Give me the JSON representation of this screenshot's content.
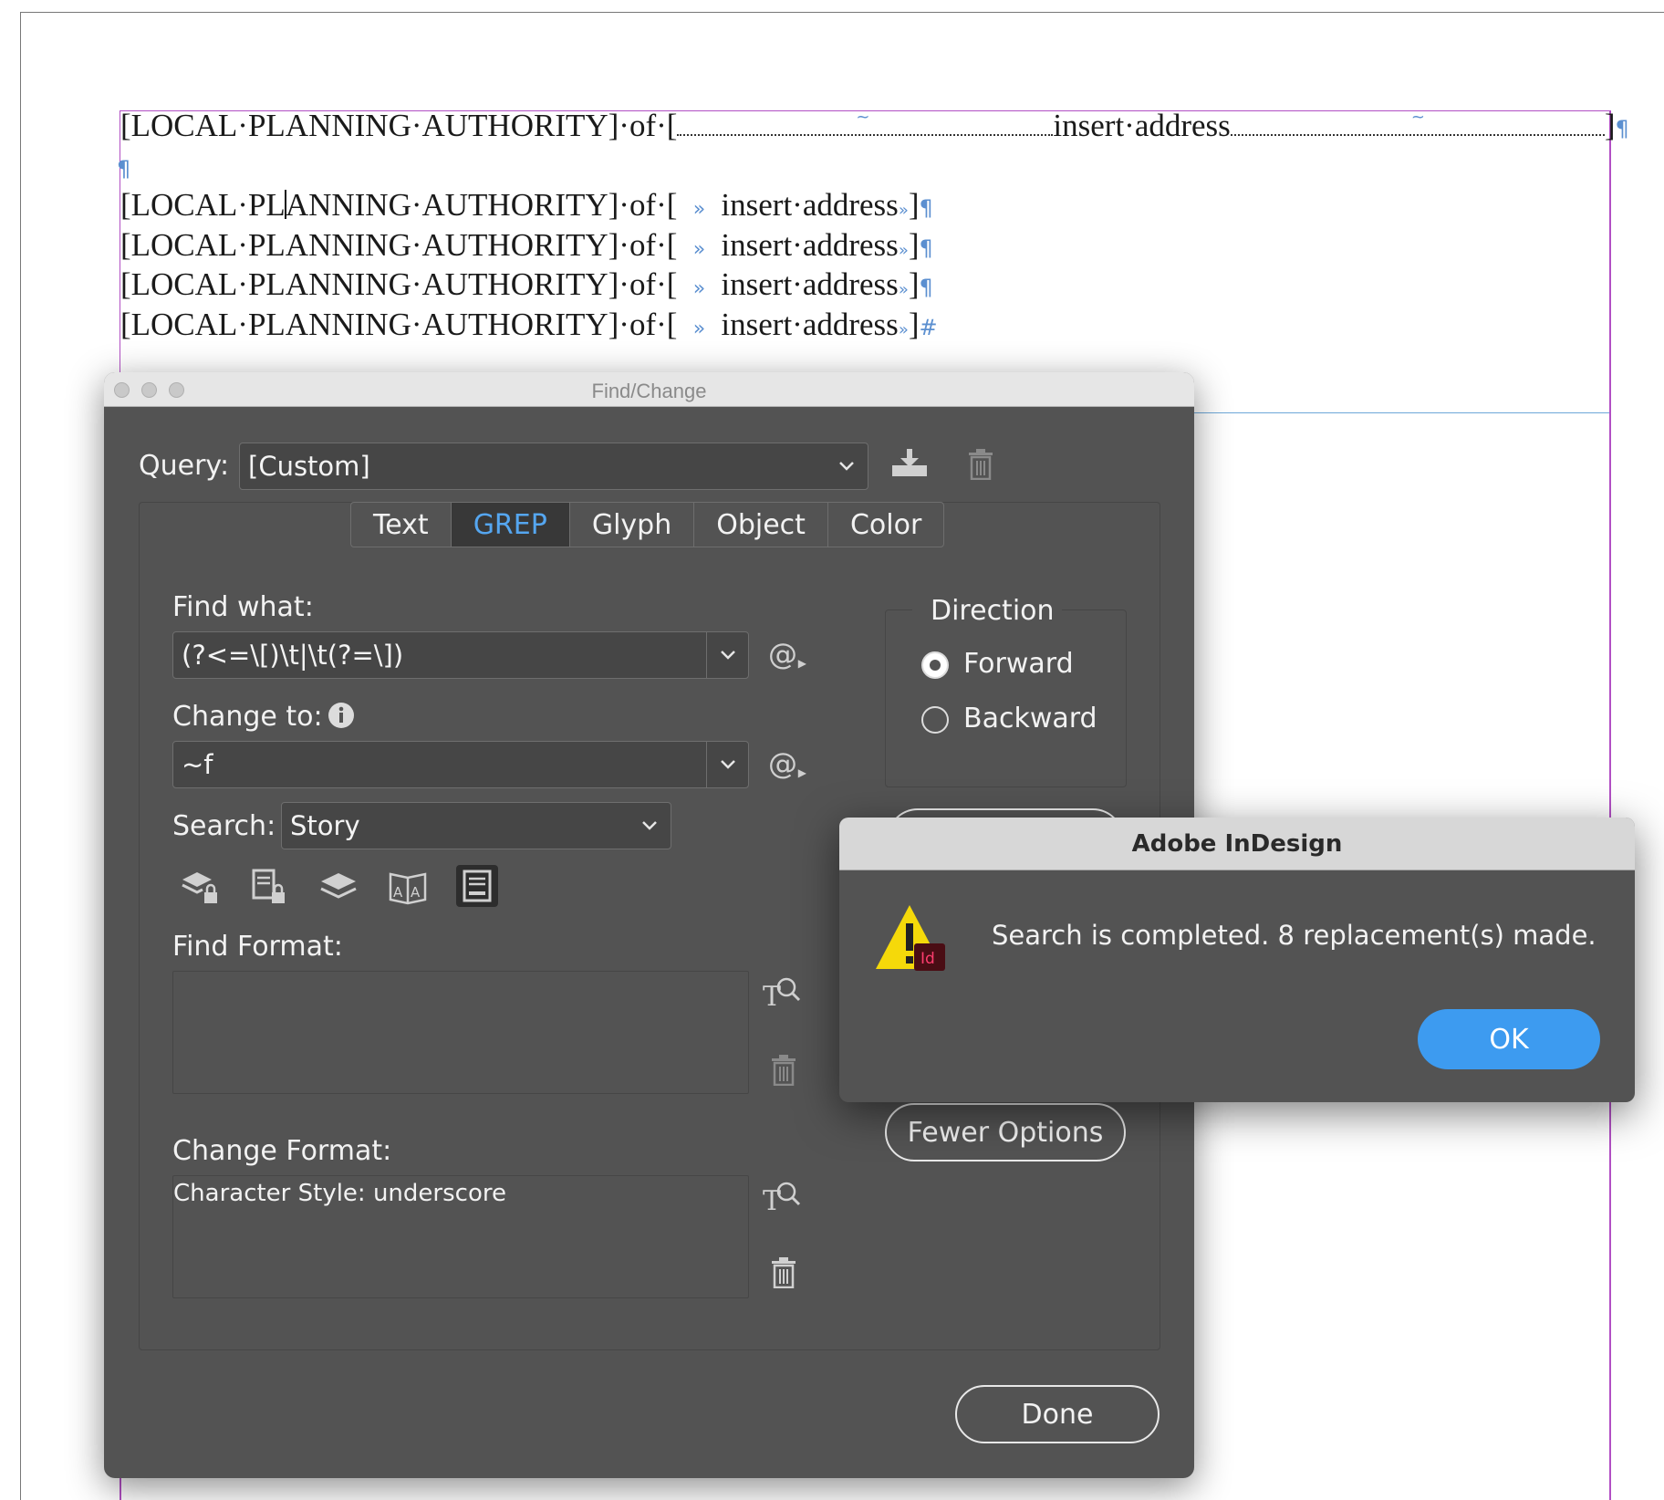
{
  "document": {
    "line1": {
      "prefix": "[LOCAL·PLANNING·AUTHORITY]·of·[",
      "middle": "insert·address",
      "suffix": "]",
      "end_mark": "¶"
    },
    "empty_para_mark": "¶",
    "lines": [
      {
        "part1": "[LOCAL·PL",
        "part2": "ANNING·AUTHORITY]·of·[",
        "tab": "»",
        "address": "insert·address",
        "tab_end": "»",
        "close": "]",
        "end_mark": "¶"
      },
      {
        "part1": "[LOCAL·PLANNING·AUTHORITY]·of·[",
        "tab": "»",
        "address": "insert·address",
        "tab_end": "»",
        "close": "]",
        "end_mark": "¶"
      },
      {
        "part1": "[LOCAL·PLANNING·AUTHORITY]·of·[",
        "tab": "»",
        "address": "insert·address",
        "tab_end": "»",
        "close": "]",
        "end_mark": "¶"
      },
      {
        "part1": "[LOCAL·PLANNING·AUTHORITY]·of·[",
        "tab": "»",
        "address": "insert·address",
        "tab_end": "»",
        "close": "]",
        "end_mark": "#"
      }
    ],
    "tilde_mark": "~"
  },
  "dialog": {
    "title": "Find/Change",
    "query_label": "Query:",
    "query_value": "[Custom]",
    "tabs": [
      {
        "label": "Text",
        "active": false
      },
      {
        "label": "GREP",
        "active": true
      },
      {
        "label": "Glyph",
        "active": false
      },
      {
        "label": "Object",
        "active": false
      },
      {
        "label": "Color",
        "active": false
      }
    ],
    "find_what_label": "Find what:",
    "find_what_value": "(?<=\\[)\\t|\\t(?=\\])",
    "change_to_label": "Change to:",
    "change_to_value": "~f",
    "search_label": "Search:",
    "search_value": "Story",
    "direction_label": "Direction",
    "forward_label": "Forward",
    "backward_label": "Backward",
    "direction_selected": "Forward",
    "find_format_label": "Find Format:",
    "find_format_value": "",
    "change_format_label": "Change Format:",
    "change_format_value": "Character Style: underscore",
    "fewer_options_label": "Fewer Options",
    "done_label": "Done",
    "at_symbol": "@"
  },
  "alert": {
    "title": "Adobe InDesign",
    "message": "Search is completed.  8 replacement(s) made.",
    "ok_label": "OK",
    "badge": "Id"
  },
  "colors": {
    "dialog_bg": "#535353",
    "accent_blue": "#3d9bf0",
    "active_tab_text": "#55a6f0",
    "frame_magenta": "#b24fc4",
    "hidden_char_blue": "#5b8fd0"
  }
}
